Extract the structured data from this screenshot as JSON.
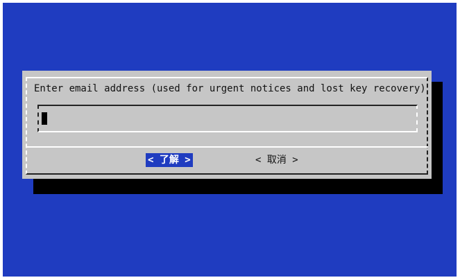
{
  "dialog": {
    "prompt": "Enter email address (used for urgent notices and lost key recovery)",
    "input_value": ""
  },
  "buttons": {
    "ok_label": "< 了解 >",
    "cancel_label": "< 取消 >"
  },
  "colors": {
    "background": "#1f3cc0",
    "dialog": "#c6c6c6",
    "shadow": "#000000",
    "selected_button": "#1f3cc0"
  }
}
